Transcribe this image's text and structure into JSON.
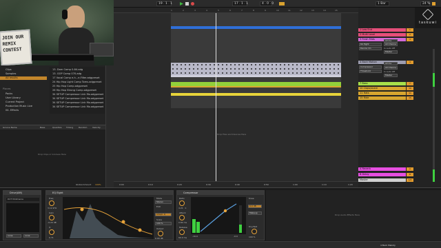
{
  "transport": {
    "tempo": "19 . 1 . 1",
    "position": "17 . 1 . 1",
    "loop_length": "4 . 0 . 0",
    "right_readout": "1 Bar",
    "cpu": "24 %"
  },
  "webcam": {
    "sign_text": "JOIN OUR REMIX CONTEST"
  },
  "browser": {
    "categories": [
      "Clips",
      "Samples",
      "All results"
    ],
    "places_heading": "Places",
    "places": [
      "Packs",
      "User Library",
      "Current Project",
      "Production Music Live",
      "04. Effects"
    ],
    "files": [
      "13. Dom Comp 0-84.adg",
      "13. GOP Comp 070.adg",
      "17 Vocal Comp e-h...e-Filter.adgpreset",
      "24 Hip Hop Light Comp Toms.adgpreset",
      "25 Hip Hop Comp.adgpreset",
      "26 Hip Hop Strong Comp.adgpreset",
      "34 SETUP Compressor Link Mo.adgpreset",
      "34 SETUP Compressor Link Mo.adgpreset",
      "34 SETUP Compressor Link Mo.adgpreset",
      "34 SETUP Compressor Link Mo.adgpreset"
    ],
    "footer": "Groove Pool"
  },
  "groove": {
    "columns": [
      "Groove Name",
      "Base",
      "Quantize",
      "Timing",
      "Random",
      "Velocity"
    ],
    "hint": "Drop Clips or Grooves Here",
    "global_amount_label": "Global Amount",
    "global_amount": "100%"
  },
  "arrangement": {
    "ruler": [
      "1",
      "2",
      "3",
      "4",
      "5",
      "6",
      "7",
      "8",
      "9",
      "10",
      "11",
      "12",
      "13",
      "14",
      "15",
      "16"
    ],
    "times": [
      "0:00",
      "0:10",
      "0:20",
      "0:30",
      "0:40",
      "0:50",
      "1:00",
      "1:10",
      "1:20"
    ],
    "drop_hint": "Drop Files and Devices Here"
  },
  "tracks": [
    {
      "name": "1 Low End",
      "color": "#e64f7a",
      "num": "1"
    },
    {
      "name": "2 Multi Level",
      "color": "#e64f7a",
      "num": "2"
    },
    {
      "name": "3 Fresh Mids",
      "color": "#d36ad8",
      "num": "3",
      "in": "All Ins",
      "mon": "In Auto Off"
    },
    {
      "name": "4 Back Motion",
      "color": "#9d9db0",
      "num": "4",
      "in": "All Ins",
      "mon": "In Auto Off"
    },
    {
      "name": "7 Bass",
      "color": "#a7e04a",
      "num": "7"
    },
    {
      "name": "10 Claps/snare",
      "color": "#d8a62f",
      "num": "10"
    },
    {
      "name": "11 Hats",
      "color": "#d8a62f",
      "num": "11"
    },
    {
      "name": "15 Ride",
      "color": "#d8a62f",
      "num": "15"
    },
    {
      "name": "A Reverb",
      "color": "#e64fe0",
      "num": "A"
    },
    {
      "name": "B Delay",
      "color": "#e64fe0",
      "num": "B"
    },
    {
      "name": "Master",
      "color": "#cfcfcf",
      "num": "1/2"
    }
  ],
  "routing": {
    "kb_eight": "Kb Eight",
    "device_on": "Device On",
    "all_channels": "All Channe",
    "compressor": "Compressor",
    "threshold": "Threshold",
    "master": "Master"
  },
  "brand": "taskuwi",
  "devices": {
    "instrument": {
      "title": "Drive(AM)",
      "preset": "DUT Midimania",
      "sel1": "none",
      "sel2": "none"
    },
    "eq": {
      "title": "EQ Eight",
      "freq_label": "Freq",
      "freq": "3.12 kHz",
      "gain_label": "Gain",
      "gain": "-9.20 dB",
      "q_label": "Q",
      "q": "0.71",
      "mode_label": "Mode",
      "mode": "Stereo",
      "edit_label": "Edit",
      "adapt": "Adapt. Q",
      "scale_label": "Scale",
      "scale": "100 %",
      "output_label": "Output",
      "output": "0.00 dB"
    },
    "comp": {
      "title": "Compressor",
      "ratio_label": "Ratio",
      "ratio": "4.21 : 1",
      "attack_label": "Attack",
      "attack": "0.84 ms",
      "release_label": "Release",
      "release": "60.0 ms",
      "thresh": "-19.9",
      "gr": "-0.0",
      "knee_label": "Knee",
      "knee": "6.0 dB",
      "makeup": "Makeup",
      "dry_label": "Dry/Wet",
      "dry": "100 %",
      "bottom": "Knee 0.0 dB  Lookah 0 ms  Env"
    },
    "audio_drop": "Drop Audio Effects Here"
  },
  "status": {
    "track": "4 Back Melody"
  }
}
